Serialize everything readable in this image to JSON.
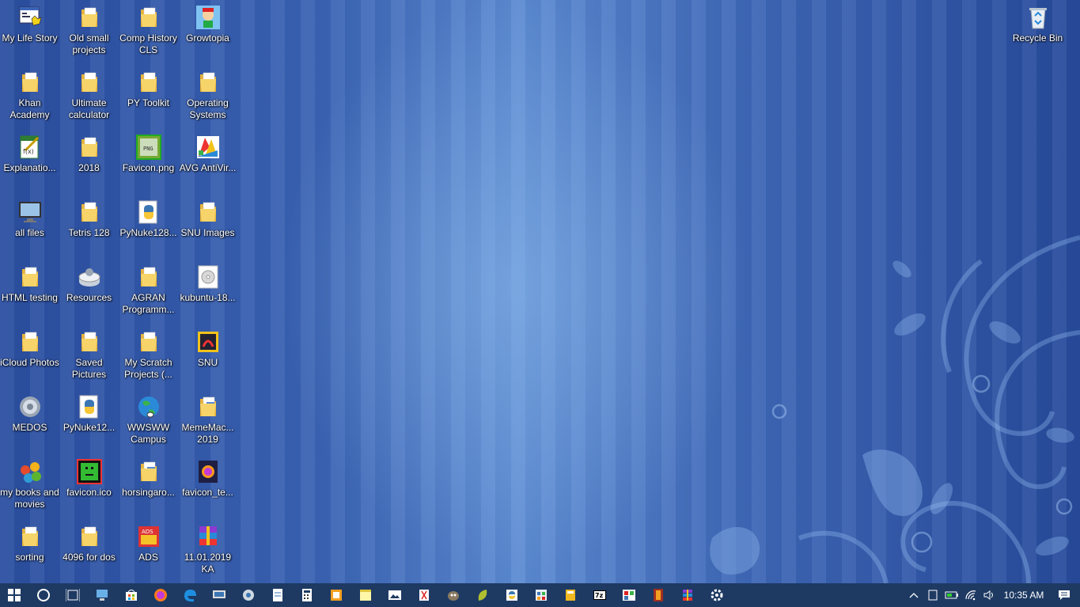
{
  "desktop": {
    "icons": [
      {
        "label": "My Life Story",
        "type": "app"
      },
      {
        "label": "Khan Academy",
        "type": "folder"
      },
      {
        "label": "Explanatio...",
        "type": "doc-green"
      },
      {
        "label": "all files",
        "type": "monitor"
      },
      {
        "label": "HTML testing",
        "type": "folder"
      },
      {
        "label": "iCloud Photos",
        "type": "folder"
      },
      {
        "label": "MEDOS",
        "type": "gear"
      },
      {
        "label": "my books and movies",
        "type": "msn"
      },
      {
        "label": "sorting",
        "type": "folder"
      },
      {
        "label": "Old small projects",
        "type": "folder"
      },
      {
        "label": "Ultimate calculator",
        "type": "folder"
      },
      {
        "label": "2018",
        "type": "folder"
      },
      {
        "label": "Tetris 128",
        "type": "folder"
      },
      {
        "label": "Resources",
        "type": "drive"
      },
      {
        "label": "Saved Pictures",
        "type": "folder"
      },
      {
        "label": "PyNuke12...",
        "type": "python"
      },
      {
        "label": "favicon.ico",
        "type": "favicon"
      },
      {
        "label": "4096 for dos",
        "type": "folder"
      },
      {
        "label": "Comp History CLS",
        "type": "folder"
      },
      {
        "label": "PY Toolkit",
        "type": "folder"
      },
      {
        "label": "Favicon.png",
        "type": "png"
      },
      {
        "label": "PyNuke128...",
        "type": "python"
      },
      {
        "label": "AGRAN Programm...",
        "type": "folder"
      },
      {
        "label": "My Scratch Projects (...",
        "type": "folder"
      },
      {
        "label": "WWSWW Campus",
        "type": "globe"
      },
      {
        "label": "horsingaro...",
        "type": "folder-file"
      },
      {
        "label": "ADS",
        "type": "ads"
      },
      {
        "label": "Growtopia",
        "type": "game"
      },
      {
        "label": "Operating Systems",
        "type": "folder"
      },
      {
        "label": "AVG AntiVir...",
        "type": "avg"
      },
      {
        "label": "SNU Images",
        "type": "folder"
      },
      {
        "label": "kubuntu-18...",
        "type": "disc"
      },
      {
        "label": "SNU",
        "type": "snu"
      },
      {
        "label": "MemeMac... 2019",
        "type": "folder-file"
      },
      {
        "label": "favicon_te...",
        "type": "firefox-file"
      },
      {
        "label": "11.01.2019 KA",
        "type": "winrar"
      },
      {
        "label": "Recycle Bin",
        "type": "recycle"
      }
    ]
  },
  "taskbar": {
    "items": [
      {
        "name": "start-button",
        "icon": "windows"
      },
      {
        "name": "cortana-button",
        "icon": "circle"
      },
      {
        "name": "task-view-button",
        "icon": "taskview"
      },
      {
        "name": "this-pc-app",
        "icon": "pc"
      },
      {
        "name": "store-app",
        "icon": "store"
      },
      {
        "name": "firefox-app",
        "icon": "firefox"
      },
      {
        "name": "edge-app",
        "icon": "edge"
      },
      {
        "name": "remote-desktop-app",
        "icon": "remote"
      },
      {
        "name": "network-app",
        "icon": "network"
      },
      {
        "name": "notepad-app",
        "icon": "notepad"
      },
      {
        "name": "calculator-app",
        "icon": "calculator"
      },
      {
        "name": "sketch-app",
        "icon": "sketch"
      },
      {
        "name": "sticky-notes-app",
        "icon": "sticky"
      },
      {
        "name": "photos-app",
        "icon": "photos"
      },
      {
        "name": "snipping-app",
        "icon": "snip"
      },
      {
        "name": "gimp-app",
        "icon": "gimp"
      },
      {
        "name": "leaf-app",
        "icon": "leaf"
      },
      {
        "name": "python-idle-app",
        "icon": "idle"
      },
      {
        "name": "control-panel-app",
        "icon": "control"
      },
      {
        "name": "files-app",
        "icon": "files"
      },
      {
        "name": "7zip-app",
        "icon": "7z"
      },
      {
        "name": "paint-app",
        "icon": "paint"
      },
      {
        "name": "film-app",
        "icon": "film"
      },
      {
        "name": "winrar-app",
        "icon": "winrar"
      },
      {
        "name": "settings-app",
        "icon": "settings"
      }
    ],
    "tray": {
      "time": "10:35 AM"
    }
  },
  "colors": {
    "taskbar": "#1e3a63",
    "folder": "#f2c94c",
    "label": "#ffffff"
  }
}
